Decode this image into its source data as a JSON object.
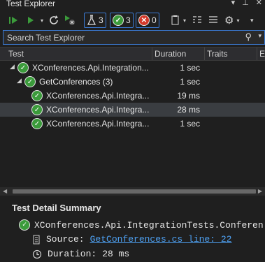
{
  "window": {
    "title": "Test Explorer"
  },
  "toolbar": {
    "flask_count": "3",
    "passed_count": "3",
    "failed_count": "0"
  },
  "search": {
    "placeholder": "Search Test Explorer"
  },
  "columns": {
    "test": "Test",
    "duration": "Duration",
    "traits": "Traits",
    "error": "E"
  },
  "rows": [
    {
      "name": "XConferences.Api.Integration...",
      "duration": "1 sec"
    },
    {
      "name": "GetConferences (3)",
      "duration": "1 sec"
    },
    {
      "name": "XConferences.Api.Integra...",
      "duration": "19 ms"
    },
    {
      "name": "XConferences.Api.Integra...",
      "duration": "28 ms"
    },
    {
      "name": "XConferences.Api.Integra...",
      "duration": "1 sec"
    }
  ],
  "detail": {
    "title": "Test Detail Summary",
    "test_name": "XConferences.Api.IntegrationTests.Conferen",
    "source_label": "Source:",
    "source_link": "GetConferences.cs line: 22",
    "duration_label": "Duration:",
    "duration_value": "28 ms"
  },
  "colors": {
    "accent": "#3b7bd4",
    "passed": "#3b9b3b",
    "failed": "#d33a2c",
    "link": "#4ea1f3"
  }
}
